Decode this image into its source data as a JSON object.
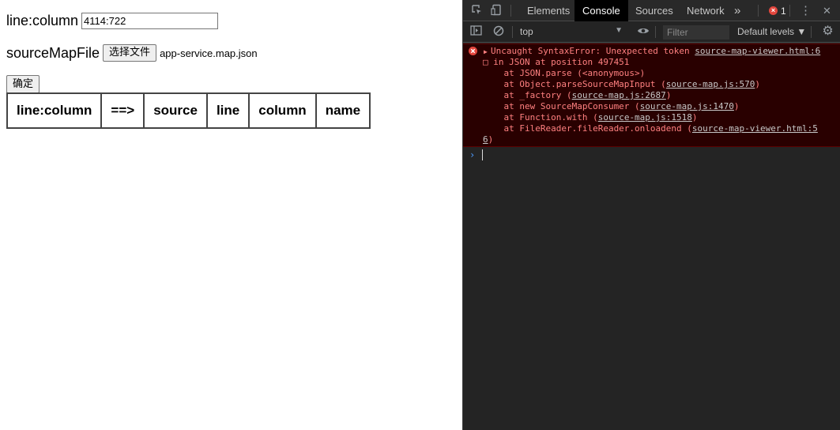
{
  "page": {
    "line_column_label": "line:column",
    "line_column_value": "4114:722",
    "source_map_label": "sourceMapFile",
    "file_button": "选择文件",
    "file_name": "app-service.map.json",
    "confirm_button": "确定",
    "table_headers": [
      "line:column",
      "==>",
      "source",
      "line",
      "column",
      "name"
    ]
  },
  "devtools": {
    "tabs": [
      "Elements",
      "Console",
      "Sources",
      "Network"
    ],
    "more_tabs": "»",
    "error_count": "1",
    "context": "top",
    "filter_placeholder": "Filter",
    "levels": "Default levels ▼",
    "error": {
      "message": "Uncaught SyntaxError: Unexpected token ",
      "location": "source-map-viewer.html:6",
      "line2": "□ in JSON at position 497451",
      "stack": [
        {
          "text": "    at JSON.parse (<anonymous>)",
          "link": ""
        },
        {
          "text": "    at Object.parseSourceMapInput (",
          "link": "source-map.js:570",
          "tail": ")"
        },
        {
          "text": "    at _factory (",
          "link": "source-map.js:2687",
          "tail": ")"
        },
        {
          "text": "    at new SourceMapConsumer (",
          "link": "source-map.js:1470",
          "tail": ")"
        },
        {
          "text": "    at Function.with (",
          "link": "source-map.js:1518",
          "tail": ")"
        },
        {
          "text": "    at FileReader.fileReader.onloadend (",
          "link": "source-map-viewer.html:5",
          "tail": ""
        }
      ],
      "wrap_link": "6",
      "wrap_tail": ")"
    },
    "prompt": "›",
    "colors": {
      "error_bg": "#290000",
      "error_text": "#ff8080",
      "active_tab": "#000000"
    }
  }
}
